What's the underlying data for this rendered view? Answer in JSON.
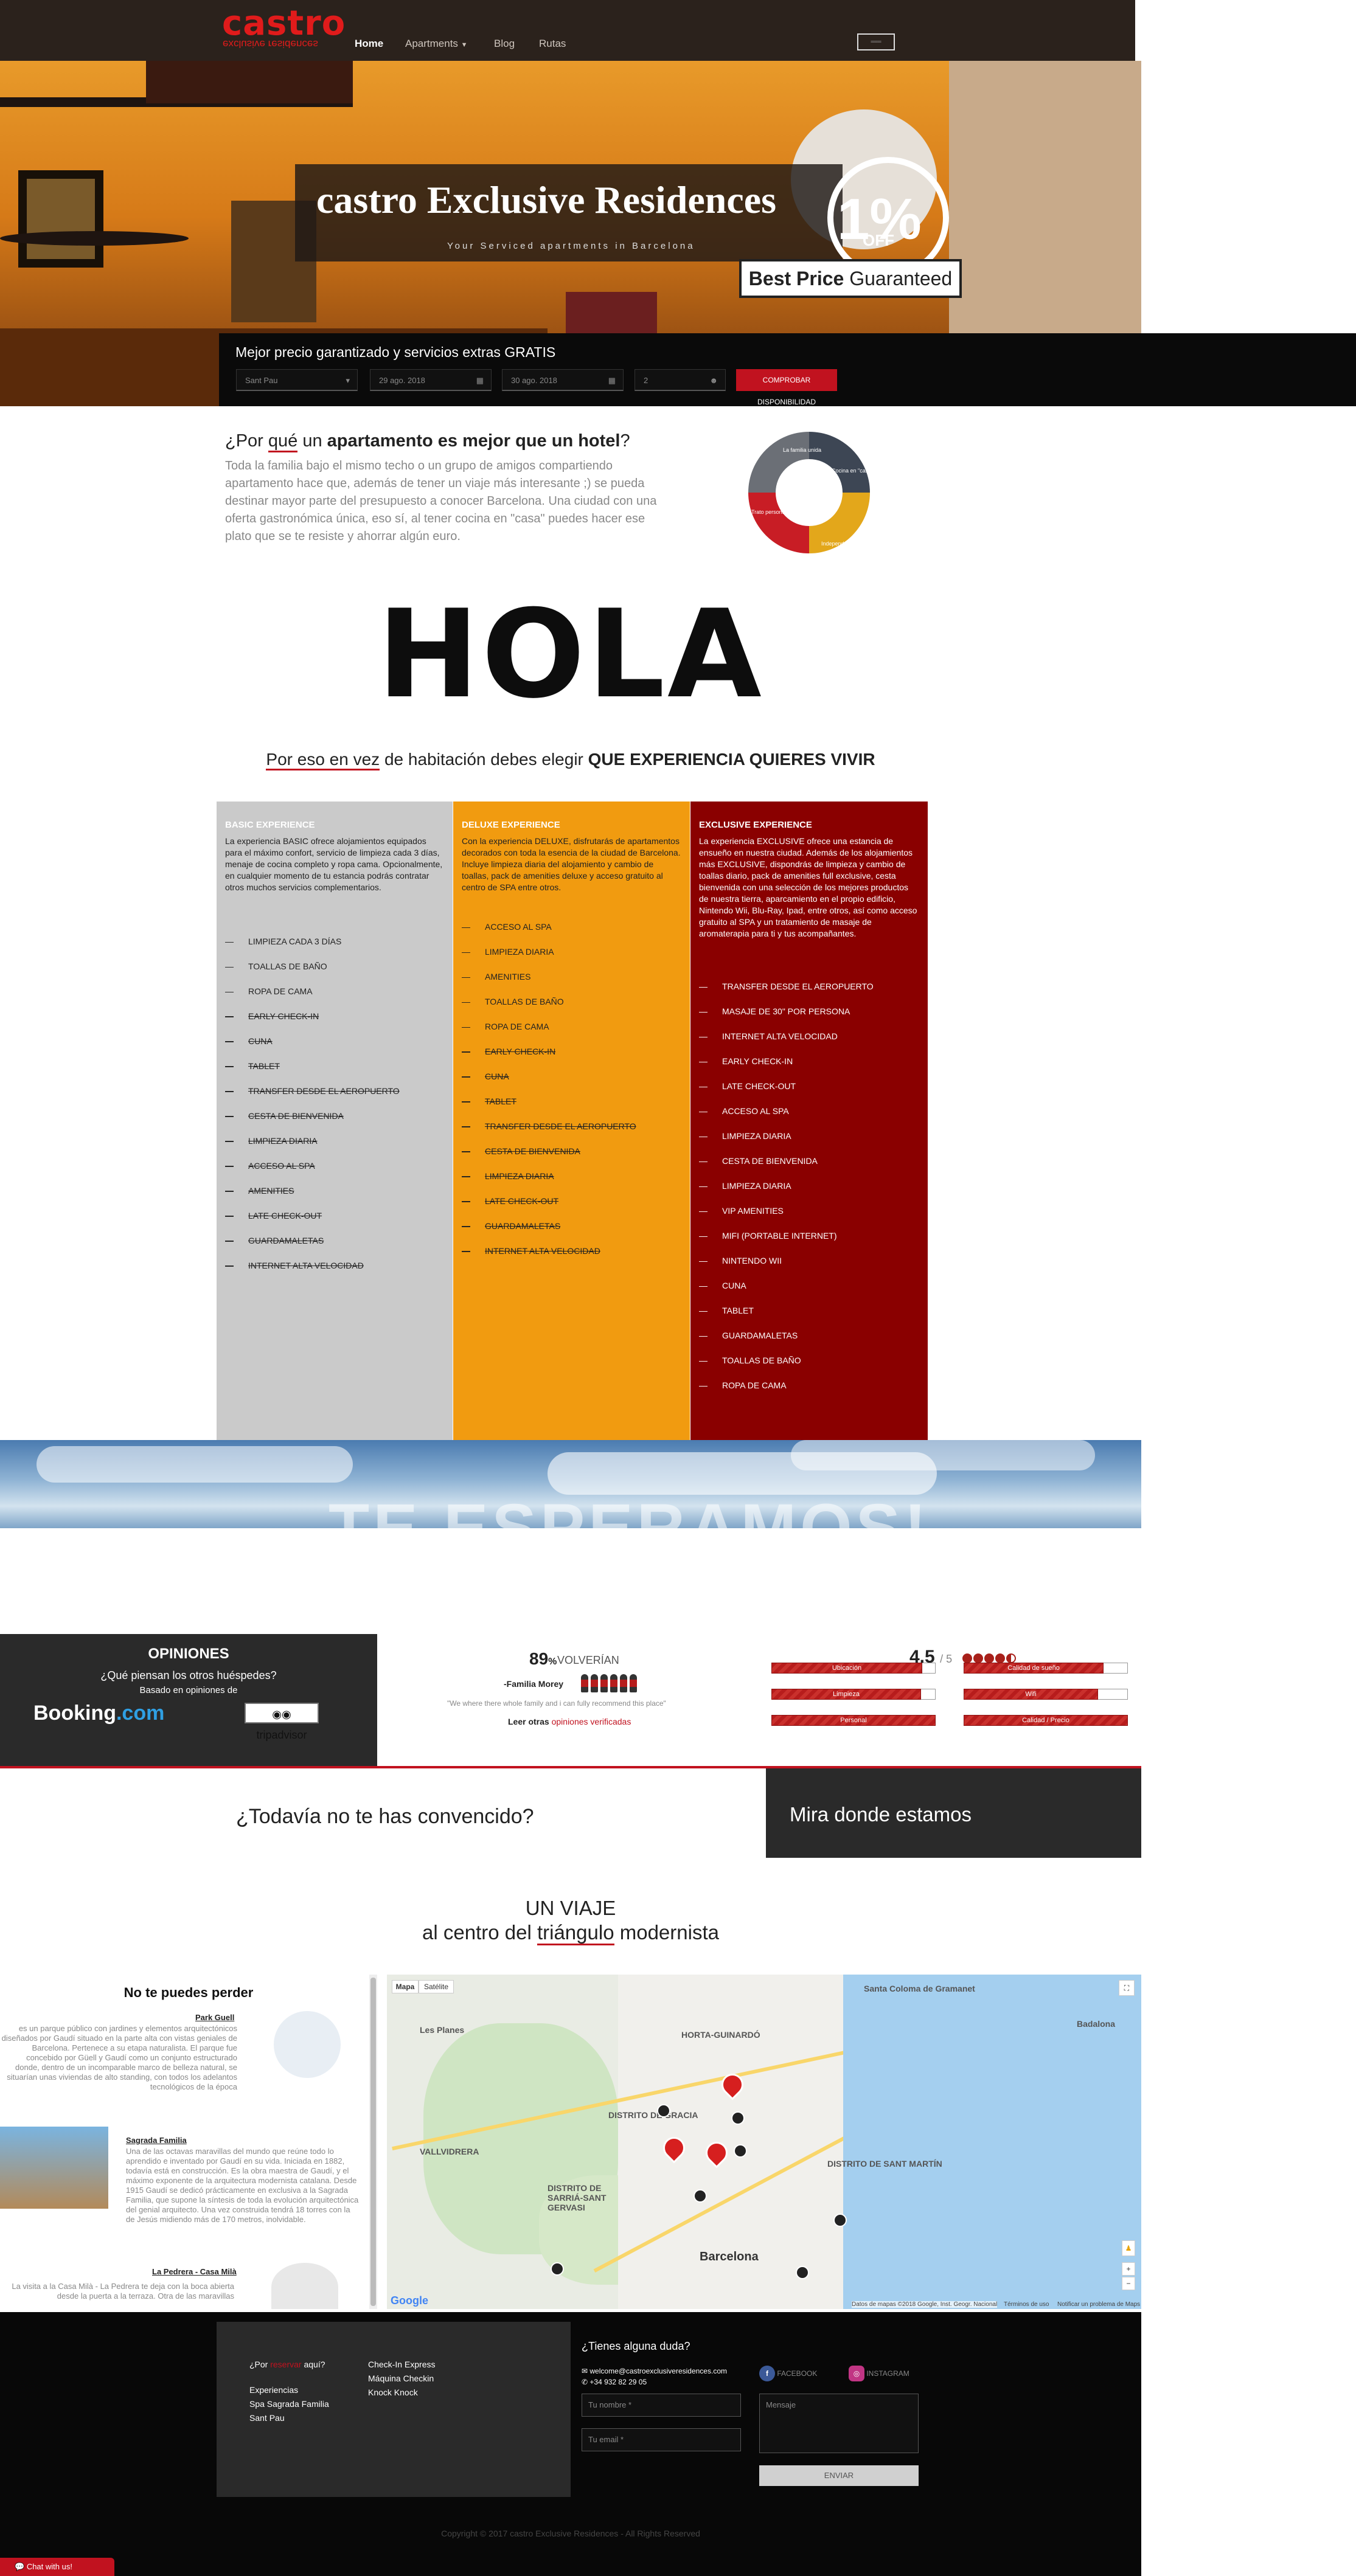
{
  "nav": {
    "logo": "castro",
    "logo_sub": "exclusive residences",
    "links": [
      "Home",
      "Apartments",
      "Blog",
      "Rutas"
    ]
  },
  "hero": {
    "title": "castro Exclusive Residences",
    "subtitle": "Your Serviced apartments in Barcelona",
    "badge_pct": "1%",
    "badge_off": "OFF",
    "best_price": "Best Price",
    "guaranteed": "Guaranteed"
  },
  "search": {
    "title": "Mejor precio garantizado y servicios extras GRATIS",
    "location": "Sant Pau",
    "checkin": "29 ago. 2018",
    "checkout": "30 ago. 2018",
    "guests": "2",
    "button": "COMPROBAR DISPONIBILIDAD"
  },
  "why": {
    "q1": "¿Por ",
    "q_u": "qué",
    "q2": " un ",
    "q_b": "apartamento es mejor que un hotel",
    "q3": "?",
    "text": "Toda la familia bajo el mismo techo o un grupo de amigos compartiendo apartamento hace que, además de tener un viaje más interesante ;) se pueda destinar mayor parte del presupuesto a conocer Barcelona. Una ciudad con una oferta gastronómica única, eso sí, al tener cocina en \"casa\" puedes hacer ese plato que se te resiste y ahorrar algún euro.",
    "wheel": [
      "La familia unida",
      "Cocina en \"casa\"",
      "Independencia",
      "Trato personal"
    ]
  },
  "hola": "HOLA",
  "experience_title": {
    "a": "Por eso en vez",
    "b": " de habitación debes elegir ",
    "c": "QUE EXPERIENCIA QUIERES VIVIR"
  },
  "columns": [
    {
      "title": "BASIC EXPERIENCE",
      "text": "La experiencia BASIC ofrece alojamientos equipados para el máximo confort, servicio de limpieza cada 3 días, menaje de cocina completo y ropa cama. Opcionalmente, en cualquier momento de tu estancia podrás contratar otros muchos servicios complementarios.",
      "included": [
        "LIMPIEZA CADA 3 DÍAS",
        "TOALLAS DE BAÑO",
        "ROPA DE CAMA"
      ],
      "excluded": [
        "EARLY CHECK-IN",
        "CUNA",
        "TABLET",
        "TRANSFER DESDE EL AEROPUERTO",
        "CESTA DE BIENVENIDA",
        "LIMPIEZA DIARIA",
        "ACCESO AL SPA",
        "AMENITIES",
        "LATE CHECK-OUT",
        "GUARDAMALETAS",
        "INTERNET ALTA VELOCIDAD"
      ]
    },
    {
      "title": "DELUXE EXPERIENCE",
      "text": "Con la experiencia DELUXE, disfrutarás de apartamentos decorados con toda la esencia de la ciudad de Barcelona. Incluye limpieza diaria del alojamiento y cambio de toallas, pack de amenities deluxe y acceso gratuito al centro de SPA entre otros.",
      "included": [
        "ACCESO AL SPA",
        "LIMPIEZA DIARIA",
        "AMENITIES",
        "TOALLAS DE BAÑO",
        "ROPA DE CAMA"
      ],
      "excluded": [
        "EARLY CHECK-IN",
        "CUNA",
        "TABLET",
        "TRANSFER DESDE EL AEROPUERTO",
        "CESTA DE BIENVENIDA",
        "LIMPIEZA DIARIA",
        "LATE CHECK-OUT",
        "GUARDAMALETAS",
        "INTERNET ALTA VELOCIDAD"
      ]
    },
    {
      "title": "EXCLUSIVE EXPERIENCE",
      "text": "La experiencia EXCLUSIVE ofrece una estancia de ensueño en nuestra ciudad. Además de los alojamientos más EXCLUSIVE, dispondrás de limpieza y cambio de toallas diario, pack de amenities full exclusive, cesta bienvenida con una selección de los mejores productos de nuestra tierra, aparcamiento en el propio edificio, Nintendo Wii, Blu-Ray, Ipad, entre otros, así como acceso gratuito al SPA y un tratamiento de masaje de aromaterapia para ti y tus acompañantes.",
      "included": [
        "TRANSFER DESDE EL AEROPUERTO",
        "MASAJE DE 30\" POR PERSONA",
        "INTERNET ALTA VELOCIDAD",
        "EARLY CHECK-IN",
        "LATE CHECK-OUT",
        "ACCESO AL SPA",
        "LIMPIEZA DIARIA",
        "CESTA DE BIENVENIDA",
        "LIMPIEZA DIARIA",
        "VIP AMENITIES",
        "MIFI (PORTABLE INTERNET)",
        "NINTENDO WII",
        "CUNA",
        "TABLET",
        "GUARDAMALETAS",
        "TOALLAS DE BAÑO",
        "ROPA DE CAMA"
      ],
      "excluded": []
    }
  ],
  "banner_text": "TE ESPERAMOS!",
  "reviews": {
    "heading": "OPINIONES",
    "question": "¿Qué piensan los otros huéspedes?",
    "based": "Basado en opiniones de",
    "booking_a": "Booking",
    "booking_b": ".com",
    "tripadvisor": "tripadvisor",
    "pct": "89",
    "pct_sign": "%",
    "volveran": "VOLVERÍAN",
    "family": "-Familia Morey",
    "quote": "\"We where there whole family and i can fully recommend this place\"",
    "leer": "Leer otras ",
    "leer_link": "opiniones verificadas",
    "score": "4.5",
    "score_of": "/ 5",
    "bars": [
      {
        "label": "Ubicación",
        "value": 0.92
      },
      {
        "label": "Calidad de sueño",
        "value": 0.85
      },
      {
        "label": "Limpieza",
        "value": 0.91
      },
      {
        "label": "Wifi",
        "value": 0.82
      },
      {
        "label": "Personal",
        "value": 1.0
      },
      {
        "label": "Calidad / Precio",
        "value": 1.0
      }
    ]
  },
  "convinced": "¿Todavía no te has convencido?",
  "mira": "Mira donde estamos",
  "viaje": {
    "line1": "UN VIAJE",
    "a": "al centro del ",
    "u": "triángulo",
    "b": " modernista"
  },
  "places": {
    "heading": "No te puedes perder",
    "items": [
      {
        "name": "Park Guell",
        "text": "es un parque público con jardines y elementos arquitectónicos diseñados por Gaudí situado en la parte alta con vistas geniales de Barcelona. Pertenece a su etapa naturalista. El parque fue concebido por Güell y Gaudí como un conjunto estructurado donde, dentro de un incomparable marco de belleza natural, se situarían unas viviendas de alto standing, con todos los adelantos tecnológicos de la época"
      },
      {
        "name": "Sagrada Familia",
        "text": "Una de las octavas maravillas del mundo que reúne todo lo aprendido e inventado por Gaudí en su vida. Iniciada en 1882, todavía está en construcción. Es la obra maestra de Gaudí, y el máximo exponente de la arquitectura modernista catalana. Desde 1915 Gaudí se dedicó prácticamente en exclusiva a la Sagrada Familia, que supone la síntesis de toda la evolución arquitectónica del genial arquitecto. Una vez construida tendrá 18 torres con la de Jesús midiendo más de 170 metros, inolvidable."
      },
      {
        "name": "La Pedrera - Casa Milà",
        "text": "La visita a la Casa Milà - La Pedrera te deja con la boca abierta desde la puerta a la terraza. Otra de las maravillas"
      }
    ]
  },
  "map": {
    "tabs": [
      "Mapa",
      "Satélite"
    ],
    "labels": [
      "Santa Coloma de Gramanet",
      "HORTA-GUINARDÓ",
      "DISTRITO DE GRACIA",
      "DISTRITO DE SARRIÁ-SANT GERVASI",
      "DISTRITO DE SANT MARTÍN",
      "Barcelona",
      "Badalona",
      "Les Planes",
      "VALLVIDRERA"
    ],
    "footer": "Datos de mapas ©2018 Google, Inst. Geogr. Nacional",
    "terms": "Términos de uso",
    "report": "Notificar un problema de Maps",
    "google": "Google"
  },
  "footer": {
    "por": "¿Por ",
    "red": "reservar",
    "aqui": " aquí?",
    "col1": [
      "Experiencias",
      "Spa Sagrada Familia",
      "Sant Pau"
    ],
    "col2": [
      "Check-In Express",
      "Máquina Checkin",
      "Knock Knock"
    ],
    "duda": "¿Tienes alguna duda?",
    "email": "welcome@castroexclusiveresidences.com",
    "phone": "+34 932 82 29 05",
    "facebook": "FACEBOOK",
    "instagram": "INSTAGRAM",
    "name_ph": "Tu nombre *",
    "email_ph": "Tu email *",
    "msg_ph": "Mensaje",
    "send": "ENVIAR",
    "copyright": "Copyright © 2017 castro Exclusive Residences - All Rights Reserved",
    "chat": "Chat with us!"
  },
  "colors": {
    "accent": "#c1121f",
    "basic": "#cacaca",
    "deluxe": "#f19b10",
    "exclusive": "#8a0000"
  }
}
